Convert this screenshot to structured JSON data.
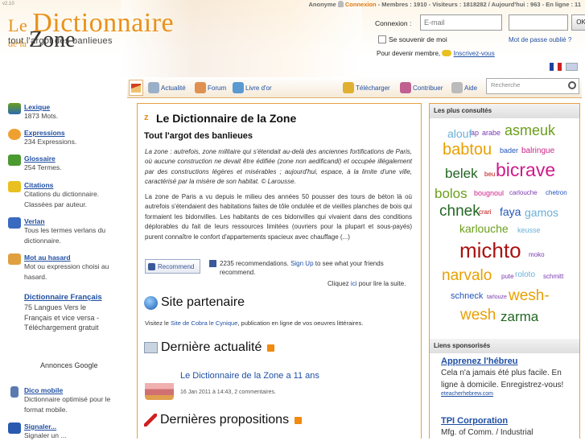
{
  "header": {
    "version": "v2.10",
    "logo": {
      "le": "Le",
      "dictionnaire": "Dictionnaire",
      "dela": "de la",
      "zone": "Zone",
      "tagline": "tout l'argot des banlieues"
    },
    "topbar": {
      "anonyme": "Anonyme",
      "connexion": "Connexion",
      "stats": "- Membres : 1910 - Visiteurs : 1818282 / Aujourd'hui : 963 - En ligne : 11"
    },
    "login": {
      "label": "Connexion :",
      "email_placeholder": "E-mail",
      "ok": "OK",
      "remember": "Se souvenir de moi",
      "forgot": "Mot de passe oublié ?",
      "become": "Pour devenir membre,",
      "register": "Inscrivez-vous"
    }
  },
  "nav": {
    "items": [
      "Actualité",
      "Forum",
      "Livre d'or",
      "Télécharger",
      "Contribuer",
      "Aide"
    ],
    "search_placeholder": "Recherche"
  },
  "sidebar": [
    {
      "title": "Lexique",
      "desc": "1873 Mots."
    },
    {
      "title": "Expressions",
      "desc": "234 Expressions."
    },
    {
      "title": "Glossaire",
      "desc": "254 Termes."
    },
    {
      "title": "Citations",
      "desc": "Citations du dictionnaire. Classées par auteur."
    },
    {
      "title": "Verlan",
      "desc": "Tous les termes verlans du dictionnaire."
    },
    {
      "title": "Mot au hasard",
      "desc": "Mot ou expression choisi au hasard."
    },
    {
      "title": "Dictionnaire Français",
      "desc": "75 Langues Vers le Français et vice versa - Téléchargement gratuit",
      "ad": "Annonces Google"
    },
    {
      "title": "Dico mobile",
      "desc": "Dictionnaire optimisé pour le format mobile."
    },
    {
      "title": "Signaler...",
      "desc": "Signaler un ..."
    }
  ],
  "main": {
    "title": "Le Dictionnaire de la Zone",
    "subtitle": "Tout l'argot des banlieues",
    "definition": "La zone : autrefois, zone militaire qui s'étendait au-delà des anciennes fortifications de Paris, où aucune construction ne devait être édifiée (zone non aedificandi) et occupée illégalement par des constructions légères et misérables ; aujourd'hui, espace, à la limite d'une ville, caractérisé par la misère de son habitat. © Larousse.",
    "paragraph": "La zone de Paris a vu depuis le milieu des années 50 pousser des tours de béton là où autrefois s'étendaient des habitations faites de tôle ondulée et de vieilles planches de bois qui formaient les bidonvilles. Les habitants de ces bidonvilles qui vivaient dans des conditions déplorables du fait de leurs ressources limitées (ouvriers pour la plupart et sous-payés) purent connaître le confort d'appartements spacieux avec chauffage (...)",
    "recommend_btn": "Recommend",
    "recommend_text": "2235 recommendations.",
    "signup": "Sign Up",
    "recommend_rest": "to see what your friends recommend.",
    "cliquez": "Cliquez",
    "ici": "ici",
    "cliquez_rest": "pour lire la suite.",
    "partner_title": "Site partenaire",
    "partner_pre": "Visitez le",
    "partner_link": "Site de Cobra le Cynique",
    "partner_post": ", publication en ligne de vos oeuvres littéraires.",
    "news_title": "Dernière actualité",
    "news_item": "Le Dictionnaire de la Zone a 11 ans",
    "news_meta": "16 Jan 2011 à 14:43, 2 commentaires.",
    "props_title": "Dernières propositions"
  },
  "right": {
    "cloud_title": "Les plus consultés",
    "cloud": [
      {
        "w": "alouf",
        "c": "#6ab0d8"
      },
      {
        "w": "ap",
        "c": "#7a3ab0"
      },
      {
        "w": "arabe",
        "c": "#7a3ab0"
      },
      {
        "w": "asmeuk",
        "c": "#6a9e1a"
      },
      {
        "w": "babtou",
        "c": "#e8a000"
      },
      {
        "w": "bader",
        "c": "#2255bb"
      },
      {
        "w": "balringue",
        "c": "#cc2288"
      },
      {
        "w": "belek",
        "c": "#226622"
      },
      {
        "w": "beu",
        "c": "#bb1111"
      },
      {
        "w": "bicrave",
        "c": "#d01a8a"
      },
      {
        "w": "bolos",
        "c": "#6a9e1a"
      },
      {
        "w": "bougnoul",
        "c": "#cc2288"
      },
      {
        "w": "carlouche",
        "c": "#7a3ab0"
      },
      {
        "w": "chetron",
        "c": "#2255bb"
      },
      {
        "w": "chnek",
        "c": "#226622"
      },
      {
        "w": "crari",
        "c": "#bb1111"
      },
      {
        "w": "faya",
        "c": "#2255bb"
      },
      {
        "w": "gamos",
        "c": "#6ab0d8"
      },
      {
        "w": "karlouche",
        "c": "#6a9e1a"
      },
      {
        "w": "keusse",
        "c": "#6ab0d8"
      },
      {
        "w": "michto",
        "c": "#aa1111"
      },
      {
        "w": "moko",
        "c": "#7a3ab0"
      },
      {
        "w": "narvalo",
        "c": "#e8a000"
      },
      {
        "w": "pute",
        "c": "#7a3ab0"
      },
      {
        "w": "roloto",
        "c": "#6ab0d8"
      },
      {
        "w": "schmitt",
        "c": "#7a3ab0"
      },
      {
        "w": "schneck",
        "c": "#2255bb"
      },
      {
        "w": "tarlouze",
        "c": "#7a3ab0"
      },
      {
        "w": "wesh-",
        "c": "#e8a000"
      },
      {
        "w": "wesh",
        "c": "#e8a000"
      },
      {
        "w": "zarma",
        "c": "#226622"
      }
    ],
    "sponsor_title": "Liens sponsorisés",
    "ads": [
      {
        "title": "Apprenez l'hébreu",
        "text": "Cela n'a jamais été plus facile. En ligne à domicile. Enregistrez-vous!",
        "url": "eteacherhebrew.com"
      },
      {
        "title": "TPI Corporation",
        "text": "Mfg. of Comm. / Industrial"
      }
    ]
  },
  "colors": {
    "accent": "#e8921a",
    "link": "#1f4fa3",
    "border": "#e8a040"
  }
}
